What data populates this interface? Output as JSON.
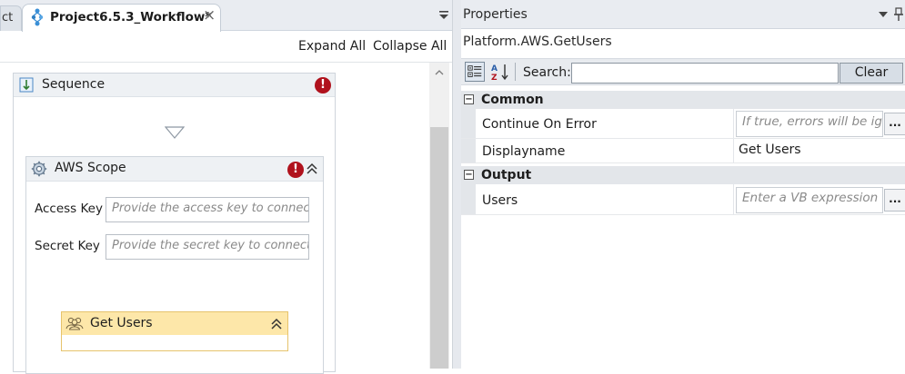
{
  "designer": {
    "prev_tab_label": "ct",
    "tab_label": "Project6.5.3_Workflow*",
    "tab_close": "×",
    "expand_all": "Expand All",
    "collapse_all": "Collapse All",
    "sequence": {
      "title": "Sequence",
      "error_mark": "!",
      "scope": {
        "title": "AWS Scope",
        "error_mark": "!",
        "access_key_label": "Access Key",
        "access_key_placeholder": "Provide the access key to connect",
        "secret_key_label": "Secret Key",
        "secret_key_placeholder": "Provide the secret key to connect",
        "child": {
          "title": "Get Users"
        }
      }
    }
  },
  "properties": {
    "panel_title": "Properties",
    "activity_name": "Platform.AWS.GetUsers",
    "search_label": "Search:",
    "search_value": "",
    "clear_label": "Clear",
    "categories": [
      {
        "toggle": "−",
        "title": "Common",
        "rows": [
          {
            "name": "Continue On Error",
            "placeholder": "If true, errors will be ign",
            "ellipsis": "..."
          },
          {
            "name": "Displayname",
            "value": "Get Users"
          }
        ]
      },
      {
        "toggle": "−",
        "title": "Output",
        "rows": [
          {
            "name": "Users",
            "placeholder": "Enter a VB expression",
            "ellipsis": "..."
          }
        ]
      }
    ]
  },
  "icons": {
    "tab": "workflow-icon",
    "sequence": "sequence-icon",
    "scope": "gear-icon",
    "activity": "users-icon",
    "error": "error-icon",
    "collapse": "double-chevron-up-icon",
    "drop": "drop-target-triangle-icon",
    "categorized": "categorized-view-icon",
    "alphabetical": "sort-alpha-icon",
    "pin": "pin-icon"
  },
  "colors": {
    "error": "#b0121d",
    "activity_header": "#fde7a9",
    "activity_border": "#e6c36c",
    "header_bg": "#eef1f4"
  }
}
